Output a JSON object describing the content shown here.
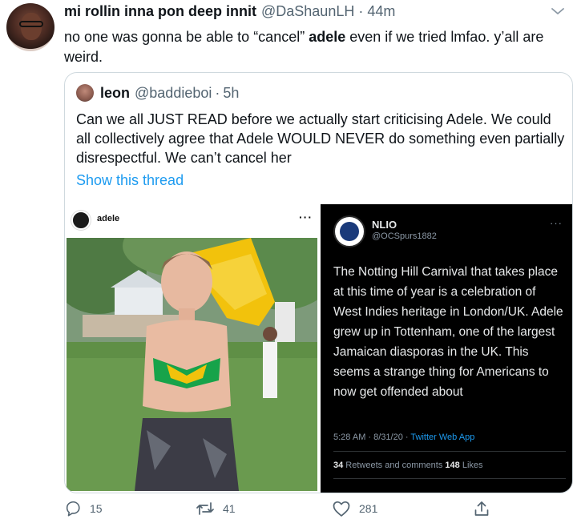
{
  "tweet": {
    "display_name": "mi rollin inna pon deep innit",
    "handle": "@DaShaunLH",
    "separator": "·",
    "time": "44m",
    "text_before": "no one was gonna be able to “cancel” ",
    "text_bold": "adele",
    "text_after": " even if we tried lmfao. y’all are weird."
  },
  "quote": {
    "display_name": "leon",
    "handle": "@baddieboi",
    "separator": "·",
    "time": "5h",
    "text": "Can we all JUST READ before we actually start criticising Adele. We could all collectively agree that Adele WOULD NEVER do something even partially disrespectful. We can’t cancel her",
    "show_thread": "Show this thread",
    "media": {
      "left": {
        "ig_username": "adele",
        "ig_more": "···"
      },
      "right": {
        "name": "NLIO",
        "handle": "@OCSpurs1882",
        "more": "···",
        "text": "The Notting Hill Carnival that takes place at this time of year is a celebration of West Indies heritage in London/UK. Adele grew up in Tottenham, one of the largest Jamaican diasporas in the UK. This seems a strange thing for Americans to now get offended about",
        "timestamp": "5:28 AM · 8/31/20 · ",
        "source": "Twitter Web App",
        "retweets_count": "34",
        "retweets_label": " Retweets and comments ",
        "likes_count": "148",
        "likes_label": " Likes"
      }
    }
  },
  "actions": {
    "reply_count": "15",
    "retweet_count": "41",
    "like_count": "281"
  },
  "colors": {
    "link": "#1d9bf0",
    "secondary_text": "#536471",
    "border": "#cfd9de"
  },
  "icons": [
    "more-icon",
    "reply-icon",
    "retweet-icon",
    "like-icon",
    "share-icon"
  ]
}
